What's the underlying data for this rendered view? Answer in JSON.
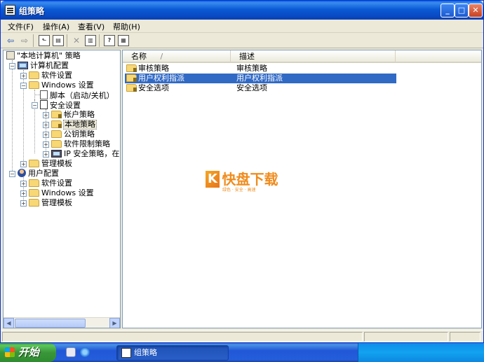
{
  "window": {
    "title": "组策略"
  },
  "menu": [
    "文件(F)",
    "操作(A)",
    "查看(V)",
    "帮助(H)"
  ],
  "toolbar": {
    "back": "⇦",
    "forward": "⇨",
    "up": "⬑",
    "show_tree": "▤",
    "delete": "✕",
    "properties": "▥",
    "help": "?",
    "view": "▦"
  },
  "tree": {
    "root": "\"本地计算机\" 策略",
    "computer_config": "计算机配置",
    "software_settings": "软件设置",
    "windows_settings": "Windows 设置",
    "scripts": "脚本（启动/关机）",
    "security_settings": "安全设置",
    "account_policies": "帐户策略",
    "local_policies": "本地策略",
    "public_key": "公钥策略",
    "software_restriction": "软件限制策略",
    "ip_security": "IP 安全策略，在",
    "admin_templates": "管理模板",
    "user_config": "用户配置",
    "user_software_settings": "软件设置",
    "user_windows_settings": "Windows 设置",
    "user_admin_templates": "管理模板"
  },
  "list": {
    "columns": {
      "name": "名称",
      "sort_mark": "/",
      "description": "描述"
    },
    "rows": [
      {
        "name": "审核策略",
        "description": "审核策略"
      },
      {
        "name": "用户权利指派",
        "description": "用户权利指派"
      },
      {
        "name": "安全选项",
        "description": "安全选项"
      }
    ]
  },
  "watermark": {
    "mark": "K",
    "text": "快盘下载",
    "tagline": "绿色 · 安全 · 高速"
  },
  "taskbar": {
    "start": "开始",
    "task": "组策略"
  }
}
